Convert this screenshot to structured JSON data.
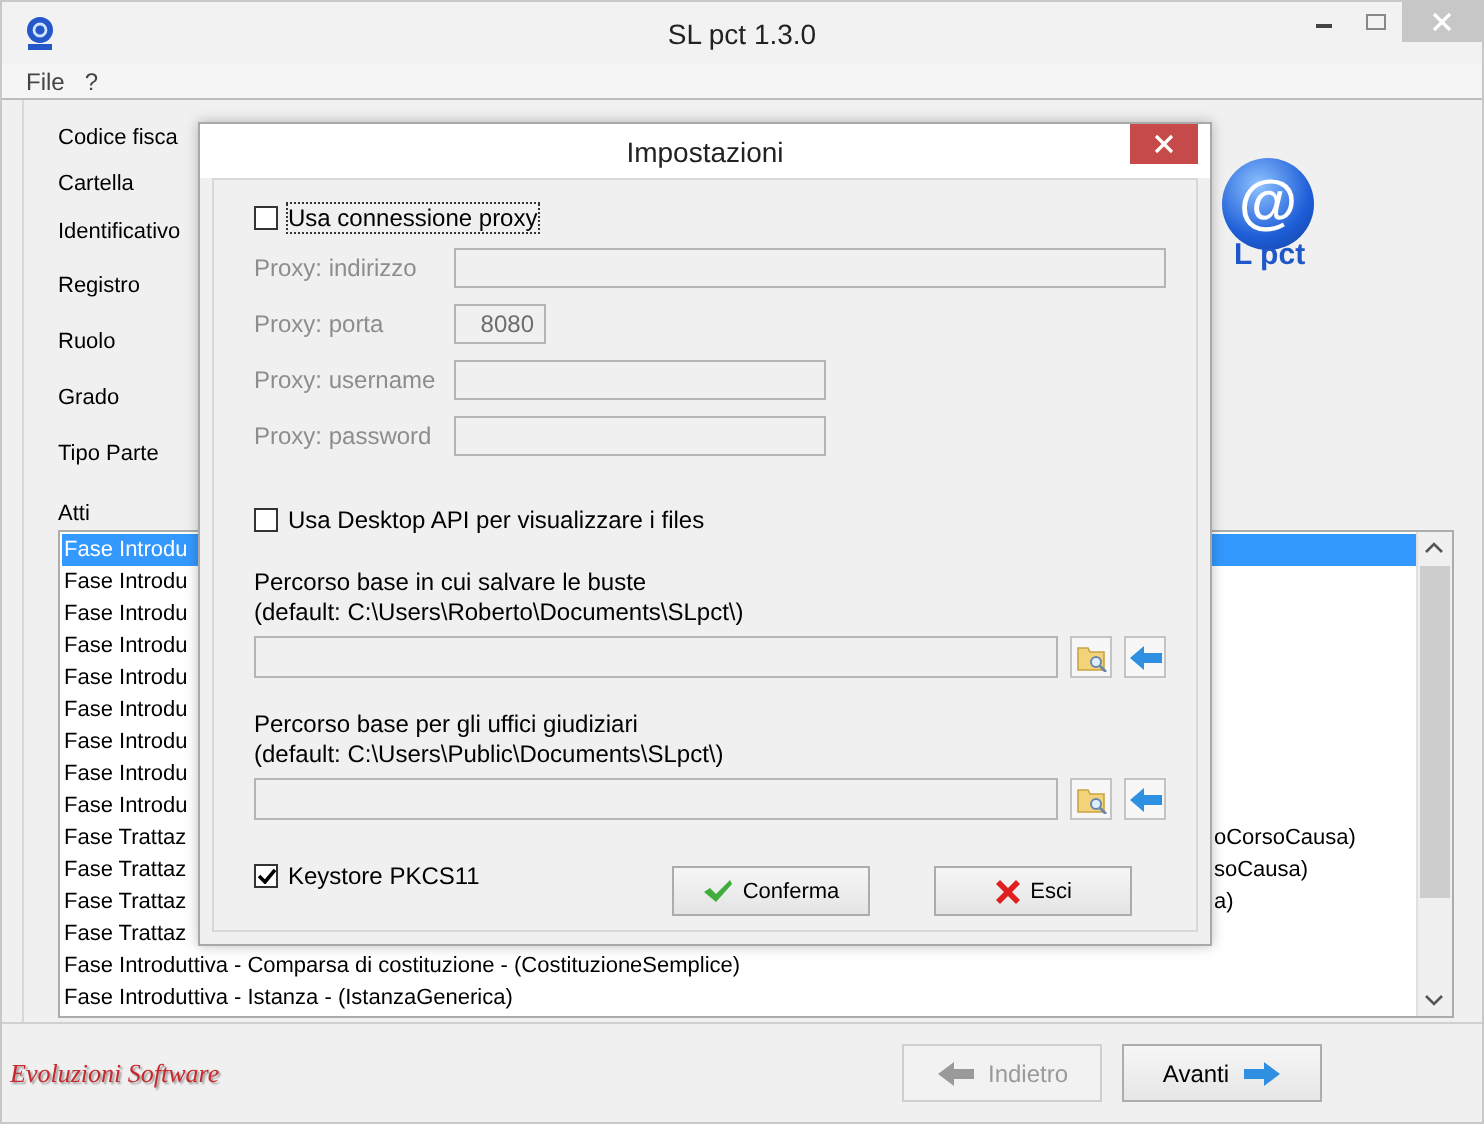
{
  "window": {
    "title": "SL pct 1.3.0"
  },
  "menu": [
    {
      "label": "File"
    },
    {
      "label": "?"
    }
  ],
  "form": {
    "labels": [
      "Codice fisca",
      "Cartella",
      "Identificativo",
      "Registro",
      "Ruolo",
      "Grado",
      "Tipo Parte"
    ],
    "list_label": "Atti"
  },
  "logo": {
    "symbol": "@",
    "caption": "L pct"
  },
  "atti": [
    {
      "text": "Fase Introdu",
      "selected": true
    },
    {
      "text": "Fase Introdu",
      "selected": false
    },
    {
      "text": "Fase Introdu",
      "selected": false
    },
    {
      "text": "Fase Introdu",
      "selected": false
    },
    {
      "text": "Fase Introdu",
      "selected": false
    },
    {
      "text": "Fase Introdu",
      "selected": false
    },
    {
      "text": "Fase Introdu",
      "selected": false
    },
    {
      "text": "Fase Introdu",
      "selected": false
    },
    {
      "text": "Fase Introdu",
      "selected": false
    },
    {
      "text": "Fase Trattaz",
      "tail": "oCorsoCausa)",
      "selected": false
    },
    {
      "text": "Fase Trattaz",
      "tail": "soCausa)",
      "selected": false
    },
    {
      "text": "Fase Trattaz",
      "tail": "a)",
      "selected": false
    },
    {
      "text": "Fase Trattaz",
      "selected": false
    },
    {
      "text": "Fase Introduttiva - Comparsa di costituzione - (CostituzioneSemplice)",
      "selected": false
    },
    {
      "text": "Fase Introduttiva - Istanza - (IstanzaGenerica)",
      "selected": false
    }
  ],
  "footer": {
    "brand": "Evoluzioni Software",
    "buttons": [
      {
        "label": "Indietro",
        "kind": "back",
        "disabled": true
      },
      {
        "label": "Avanti",
        "kind": "forward",
        "disabled": false
      }
    ]
  },
  "dialog": {
    "title": "Impostazioni",
    "proxy": {
      "label": "Usa connessione proxy",
      "checked": false
    },
    "proxy_fields": [
      {
        "label": "Proxy: indirizzo",
        "disabled": true
      },
      {
        "label": "Proxy: porta",
        "value": "8080",
        "disabled": true
      },
      {
        "label": "Proxy: username",
        "disabled": true
      },
      {
        "label": "Proxy: password",
        "disabled": true
      }
    ],
    "desktop_api": {
      "label": "Usa Desktop API per visualizzare i files",
      "checked": false
    },
    "paths": [
      {
        "label": "Percorso base in cui salvare le buste",
        "hint": "(default: C:\\Users\\Roberto\\Documents\\SLpct\\)"
      },
      {
        "label": "Percorso base per gli uffici giudiziari",
        "hint": "(default: C:\\Users\\Public\\Documents\\SLpct\\)"
      }
    ],
    "keystore": {
      "label": "Keystore PKCS11",
      "checked": true
    },
    "buttons": [
      {
        "label": "Conferma",
        "kind": "confirm"
      },
      {
        "label": "Esci",
        "kind": "exit"
      }
    ]
  }
}
